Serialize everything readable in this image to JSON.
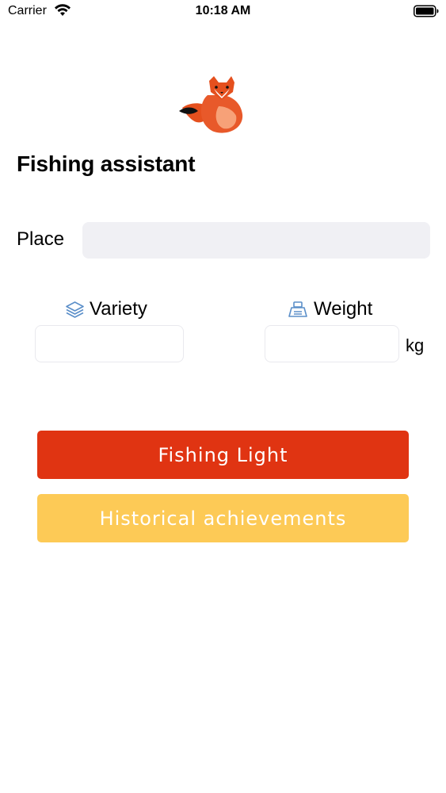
{
  "status_bar": {
    "carrier": "Carrier",
    "time": "10:18 AM"
  },
  "app": {
    "title": "Fishing assistant"
  },
  "form": {
    "place": {
      "label": "Place",
      "value": ""
    },
    "variety": {
      "label": "Variety",
      "icon": "layers-icon",
      "value": ""
    },
    "weight": {
      "label": "Weight",
      "icon": "scale-weight-icon",
      "value": "",
      "unit": "kg"
    }
  },
  "buttons": {
    "fishing_light": "Fishing Light",
    "history": "Historical achievements"
  },
  "colors": {
    "primary_button": "#e03412",
    "secondary_button": "#fdca56",
    "icon_blue": "#5b8fc9",
    "input_fill": "#f0f0f4"
  }
}
